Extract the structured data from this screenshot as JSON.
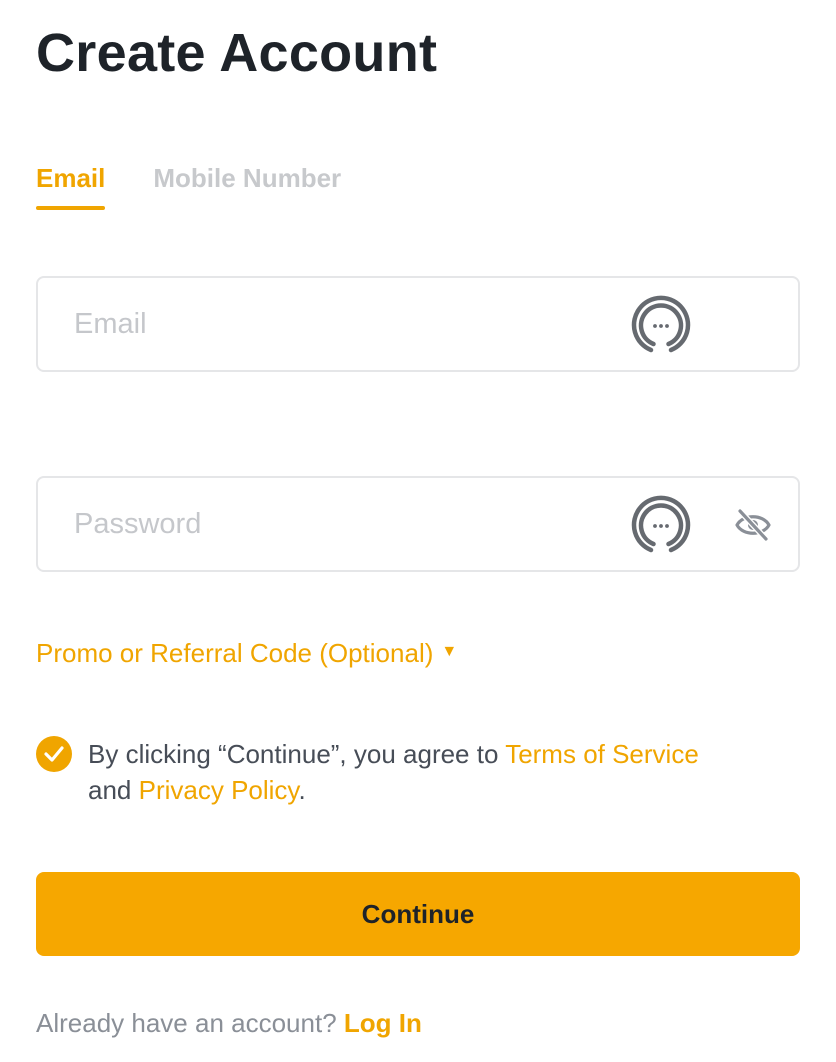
{
  "page": {
    "title": "Create Account"
  },
  "tabs": [
    {
      "label": "Email",
      "active": true
    },
    {
      "label": "Mobile Number",
      "active": false
    }
  ],
  "email_field": {
    "placeholder": "Email",
    "value": "",
    "icon": "password-manager-icon"
  },
  "password_field": {
    "placeholder": "Password",
    "value": "",
    "icons": [
      "password-manager-icon",
      "eye-slash-icon"
    ]
  },
  "promo": {
    "label": "Promo or Referral Code (Optional)",
    "icon": "caret-down-icon"
  },
  "agreement": {
    "checked": true,
    "prefix": "By clicking “Continue”, you agree to ",
    "terms_link": "Terms of Service",
    "middle": " and ",
    "privacy_link": "Privacy Policy",
    "suffix": "."
  },
  "continue_button": {
    "label": "Continue"
  },
  "login": {
    "prompt": "Already have an account? ",
    "link": "Log In"
  },
  "colors": {
    "accent": "#f0a500",
    "button": "#f6a700",
    "text": "#1e2329",
    "muted": "#8a8f97",
    "border": "#e5e6e8"
  }
}
